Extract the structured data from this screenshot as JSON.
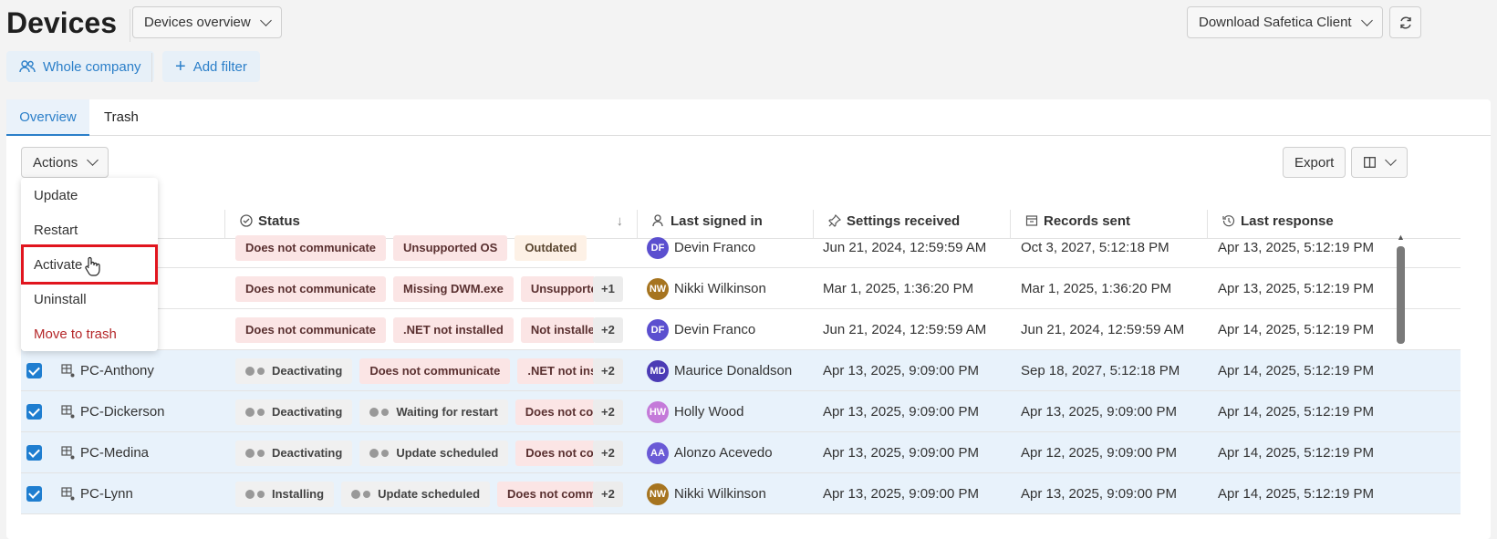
{
  "header": {
    "title": "Devices",
    "view_select": "Devices overview",
    "download_button": "Download Safetica Client"
  },
  "filters": {
    "scope": "Whole company",
    "add_filter": "Add filter"
  },
  "tabs": [
    "Overview",
    "Trash"
  ],
  "toolbar": {
    "actions_label": "Actions",
    "export_label": "Export"
  },
  "actions_menu": [
    "Update",
    "Restart",
    "Activate",
    "Uninstall",
    "Move to trash"
  ],
  "columns": {
    "status": "Status",
    "last_signed_in": "Last signed in",
    "settings_received": "Settings received",
    "records_sent": "Records sent",
    "last_response": "Last response"
  },
  "rows": [
    {
      "device": "",
      "selected": false,
      "chips": [
        "Does not communicate",
        "Unsupported OS",
        "Outdated"
      ],
      "more": "",
      "initials": "DF",
      "user": "Devin Franco",
      "settings": "Jun 21, 2024, 12:59:59 AM",
      "records": "Oct 3, 2027, 5:12:18 PM",
      "response": "Apr 13, 2025, 5:12:19 PM"
    },
    {
      "device": "",
      "selected": false,
      "chips": [
        "Does not communicate",
        "Missing DWM.exe",
        "Unsupported"
      ],
      "more": "+1",
      "initials": "NW",
      "user": "Nikki Wilkinson",
      "settings": "Mar 1, 2025, 1:36:20 PM",
      "records": "Mar 1, 2025, 1:36:20 PM",
      "response": "Apr 13, 2025, 5:12:19 PM"
    },
    {
      "device": "",
      "selected": false,
      "chips": [
        "Does not communicate",
        ".NET not installed",
        "Not installed"
      ],
      "more": "+2",
      "initials": "DF",
      "user": "Devin Franco",
      "settings": "Jun 21, 2024, 12:59:59 AM",
      "records": "Jun 21, 2024, 12:59:59 AM",
      "response": "Apr 14, 2025, 5:12:19 PM"
    },
    {
      "device": "PC-Anthony",
      "selected": true,
      "chips": [
        "Deactivating",
        "Does not communicate",
        ".NET not inst"
      ],
      "more": "+2",
      "initials": "MD",
      "user": "Maurice Donaldson",
      "settings": "Apr 13, 2025, 9:09:00 PM",
      "records": "Sep 18, 2027, 5:12:18 PM",
      "response": "Apr 14, 2025, 5:12:19 PM"
    },
    {
      "device": "PC-Dickerson",
      "selected": true,
      "chips": [
        "Deactivating",
        "Waiting for restart",
        "Does not co"
      ],
      "more": "+2",
      "initials": "HW",
      "user": "Holly Wood",
      "settings": "Apr 13, 2025, 9:09:00 PM",
      "records": "Apr 13, 2025, 9:09:00 PM",
      "response": "Apr 14, 2025, 5:12:19 PM"
    },
    {
      "device": "PC-Medina",
      "selected": true,
      "chips": [
        "Deactivating",
        "Update scheduled",
        "Does not co"
      ],
      "more": "+2",
      "initials": "AA",
      "user": "Alonzo Acevedo",
      "settings": "Apr 13, 2025, 9:09:00 PM",
      "records": "Apr 12, 2025, 9:09:00 PM",
      "response": "Apr 14, 2025, 5:12:19 PM"
    },
    {
      "device": "PC-Lynn",
      "selected": true,
      "chips": [
        "Installing",
        "Update scheduled",
        "Does not comm"
      ],
      "more": "+2",
      "initials": "NW",
      "user": "Nikki Wilkinson",
      "settings": "Apr 13, 2025, 9:09:00 PM",
      "records": "Apr 13, 2025, 9:09:00 PM",
      "response": "Apr 14, 2025, 5:12:19 PM"
    }
  ],
  "colors": {
    "accent": "#2b7fc9",
    "danger": "#b5282a",
    "highlight": "#e1151e",
    "avatar_DF": "#5b4fcf",
    "avatar_NW": "#a6741f",
    "avatar_MD": "#4b3bb5",
    "avatar_HW": "#c47ad9",
    "avatar_AA": "#6a5ad6"
  }
}
